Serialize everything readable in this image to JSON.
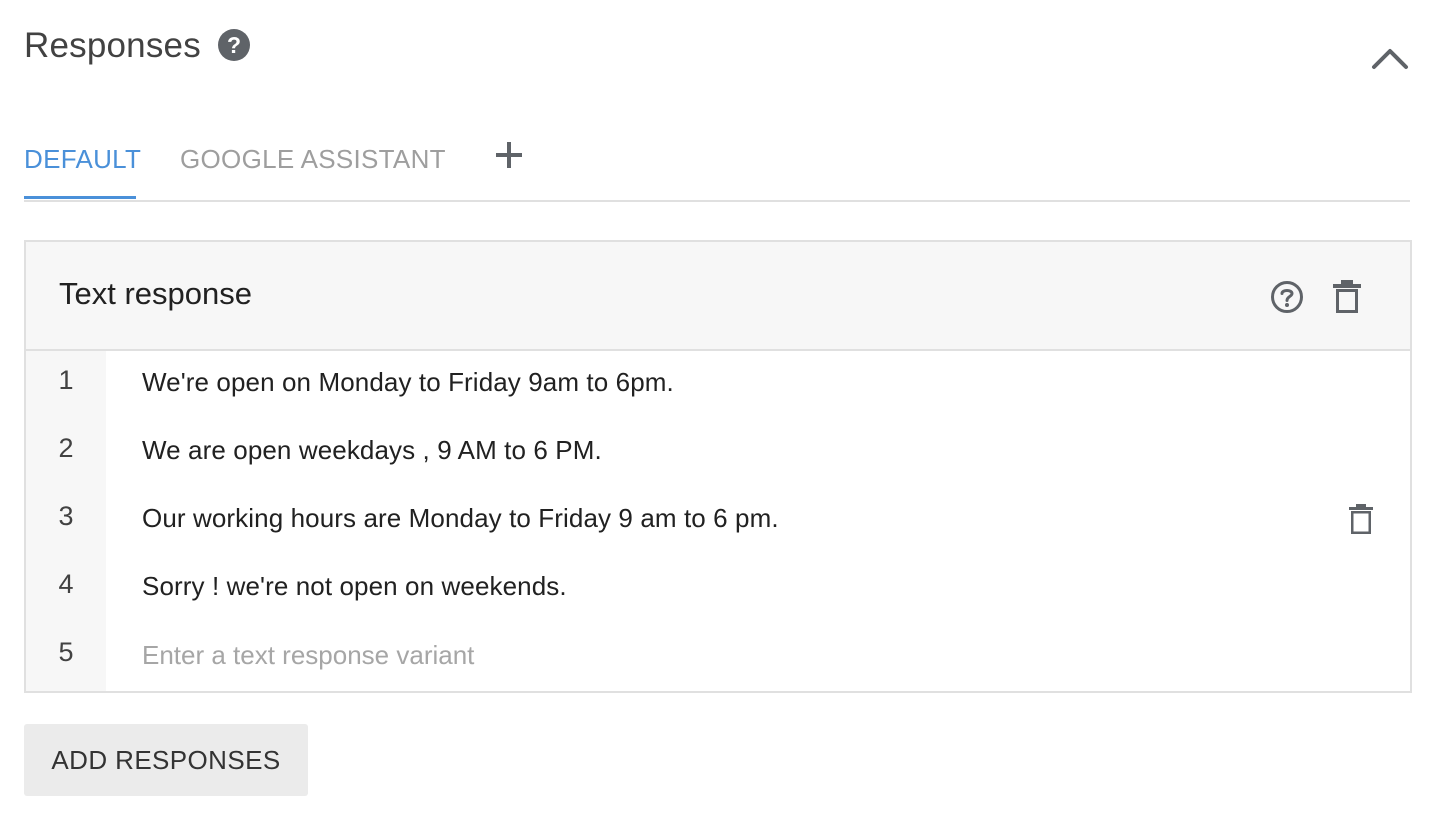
{
  "section": {
    "title": "Responses",
    "help_glyph": "?",
    "help_icon": "question-circle-filled-icon",
    "collapse_icon": "chevron-up-icon"
  },
  "tabs": [
    {
      "label": "DEFAULT",
      "active": true
    },
    {
      "label": "GOOGLE ASSISTANT",
      "active": false
    }
  ],
  "add_tab_icon": "plus-icon",
  "card": {
    "title": "Text response",
    "help_icon": "question-circle-outline-icon",
    "delete_icon": "trash-icon",
    "rows": [
      {
        "number": "1",
        "text": "We're open on Monday to Friday 9am to 6pm."
      },
      {
        "number": "2",
        "text": "We are open weekdays , 9 AM to 6 PM."
      },
      {
        "number": "3",
        "text": "Our working hours are Monday to Friday 9 am to 6 pm."
      },
      {
        "number": "4",
        "text": "Sorry ! we're not open on weekends."
      },
      {
        "number": "5",
        "placeholder": "Enter a text response variant",
        "value": ""
      }
    ]
  },
  "add_responses_label": "ADD RESPONSES",
  "colors": {
    "accent": "#4a90d9",
    "icon": "#5f6368",
    "header_bg": "#f7f7f7",
    "border": "#e0e0e0",
    "button_bg": "#ebebeb"
  }
}
